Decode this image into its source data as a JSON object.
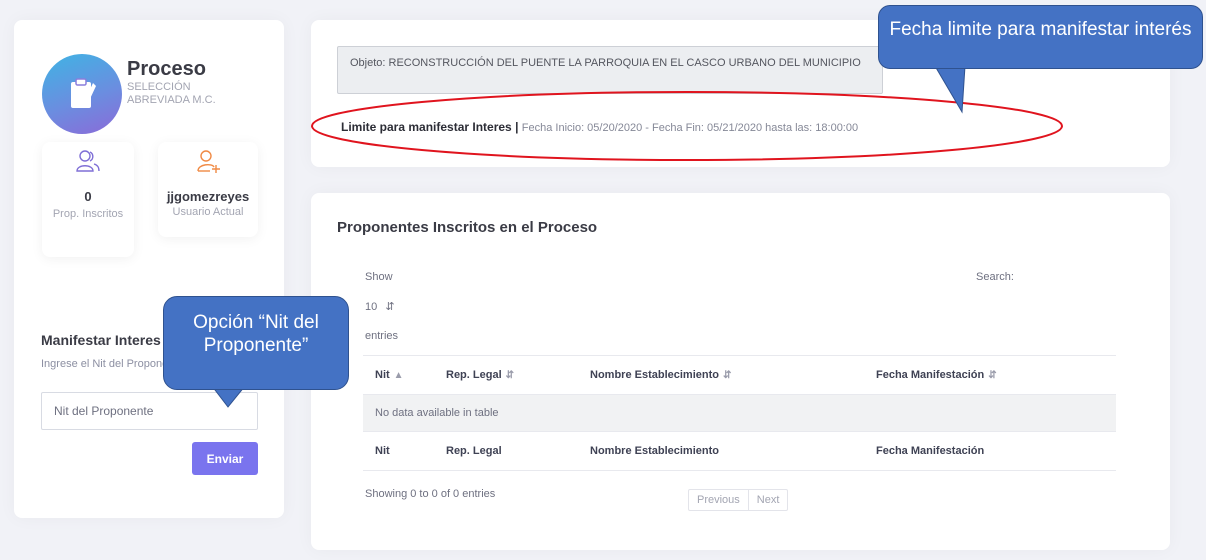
{
  "sidebar": {
    "title": "Proceso",
    "subtitle": "SELECCIÓN ABREVIADA M.C.",
    "stats": [
      {
        "value": "0",
        "label": "Prop. Inscritos",
        "icon": "users-icon"
      },
      {
        "value": "jjgomezreyes",
        "label": "Usuario Actual",
        "icon": "user-add-icon"
      }
    ],
    "manifest_title": "Manifestar Interes",
    "manifest_subtitle": "Ingrese el Nit del Proponente",
    "nit_placeholder": "Nit del Proponente",
    "submit_label": "Enviar"
  },
  "top": {
    "objeto": "Objeto: RECONSTRUCCIÓN DEL PUENTE LA PARROQUIA EN EL CASCO URBANO DEL MUNICIPIO",
    "limite_label": "Limite para manifestar Interes |",
    "limite_fechas": "Fecha Inicio: 05/20/2020 - Fecha Fin: 05/21/2020 hasta las: 18:00:00"
  },
  "table_section": {
    "title": "Proponentes Inscritos en el Proceso",
    "show_label": "Show",
    "page_length": "10",
    "entries_label": "entries",
    "search_label": "Search:",
    "columns": [
      "Nit",
      "Rep. Legal",
      "Nombre Establecimiento",
      "Fecha Manifestación"
    ],
    "empty_message": "No data available in table",
    "info": "Showing 0 to 0 of 0 entries",
    "prev_label": "Previous",
    "next_label": "Next"
  },
  "annotations": {
    "fecha_callout": "Fecha limite para manifestar interés",
    "nit_callout": "Opción “Nit del Proponente”"
  },
  "colors": {
    "accent": "#7a74ee",
    "callout": "#4472c4",
    "highlight_ellipse": "#e0141e"
  }
}
